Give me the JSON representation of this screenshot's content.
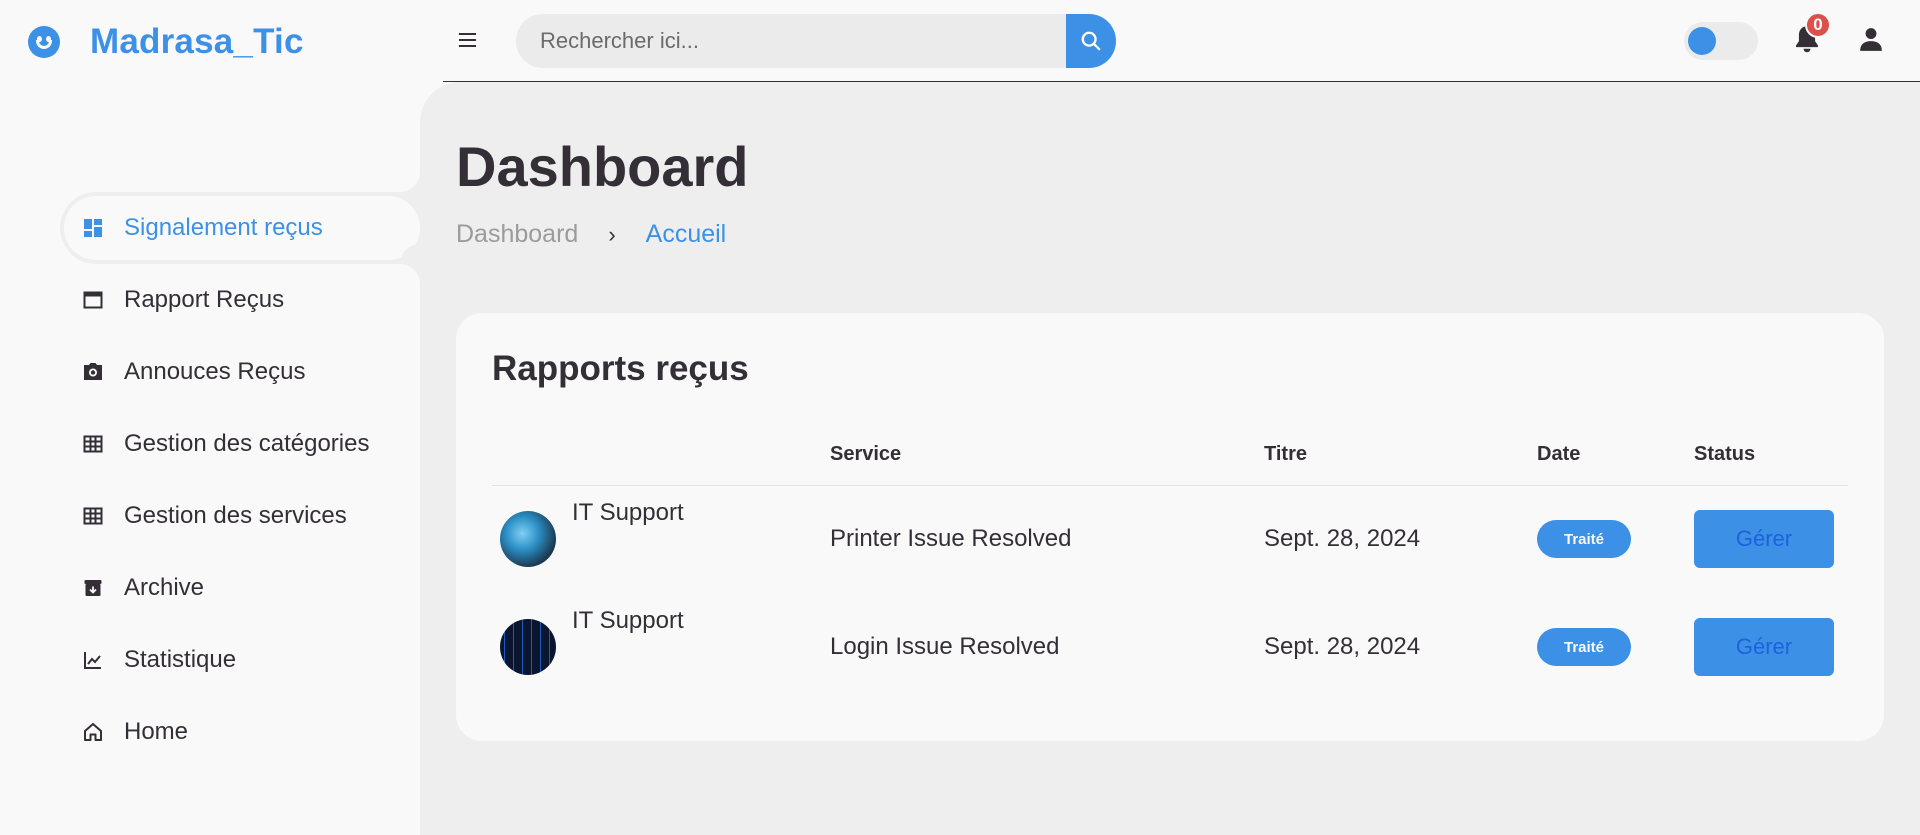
{
  "brand": {
    "name": "Madrasa_Tic",
    "icon": "smile-icon"
  },
  "header": {
    "search_placeholder": "Rechercher ici...",
    "notification_count": "0",
    "theme_toggle_on": false
  },
  "sidebar": {
    "items": [
      {
        "label": "Signalement reçus",
        "icon": "dashboard-icon",
        "active": true
      },
      {
        "label": "Rapport Reçus",
        "icon": "window-icon",
        "active": false
      },
      {
        "label": "Annouces Reçus",
        "icon": "camera-icon",
        "active": false
      },
      {
        "label": "Gestion des catégories",
        "icon": "table-icon",
        "active": false
      },
      {
        "label": "Gestion des services",
        "icon": "table-icon",
        "active": false
      },
      {
        "label": "Archive",
        "icon": "archive-icon",
        "active": false
      },
      {
        "label": "Statistique",
        "icon": "line-chart-icon",
        "active": false
      },
      {
        "label": "Home",
        "icon": "home-icon",
        "active": false
      }
    ]
  },
  "main": {
    "title": "Dashboard",
    "breadcrumb": {
      "first": "Dashboard",
      "separator": "›",
      "second": "Accueil"
    },
    "card_title": "Rapports reçus",
    "columns": [
      "",
      "Service",
      "Titre",
      "Date",
      "Status"
    ],
    "rows": [
      {
        "user": "IT Support",
        "service": "Printer Issue Resolved",
        "date": "Sept. 28, 2024",
        "status": "Traité",
        "action": "Gérer"
      },
      {
        "user": "IT Support",
        "service": "Login Issue Resolved",
        "date": "Sept. 28, 2024",
        "status": "Traité",
        "action": "Gérer"
      }
    ]
  },
  "colors": {
    "accent": "#3c91e6",
    "dark": "#342e37",
    "badge": "#db504a",
    "background": "#eeeeee"
  }
}
